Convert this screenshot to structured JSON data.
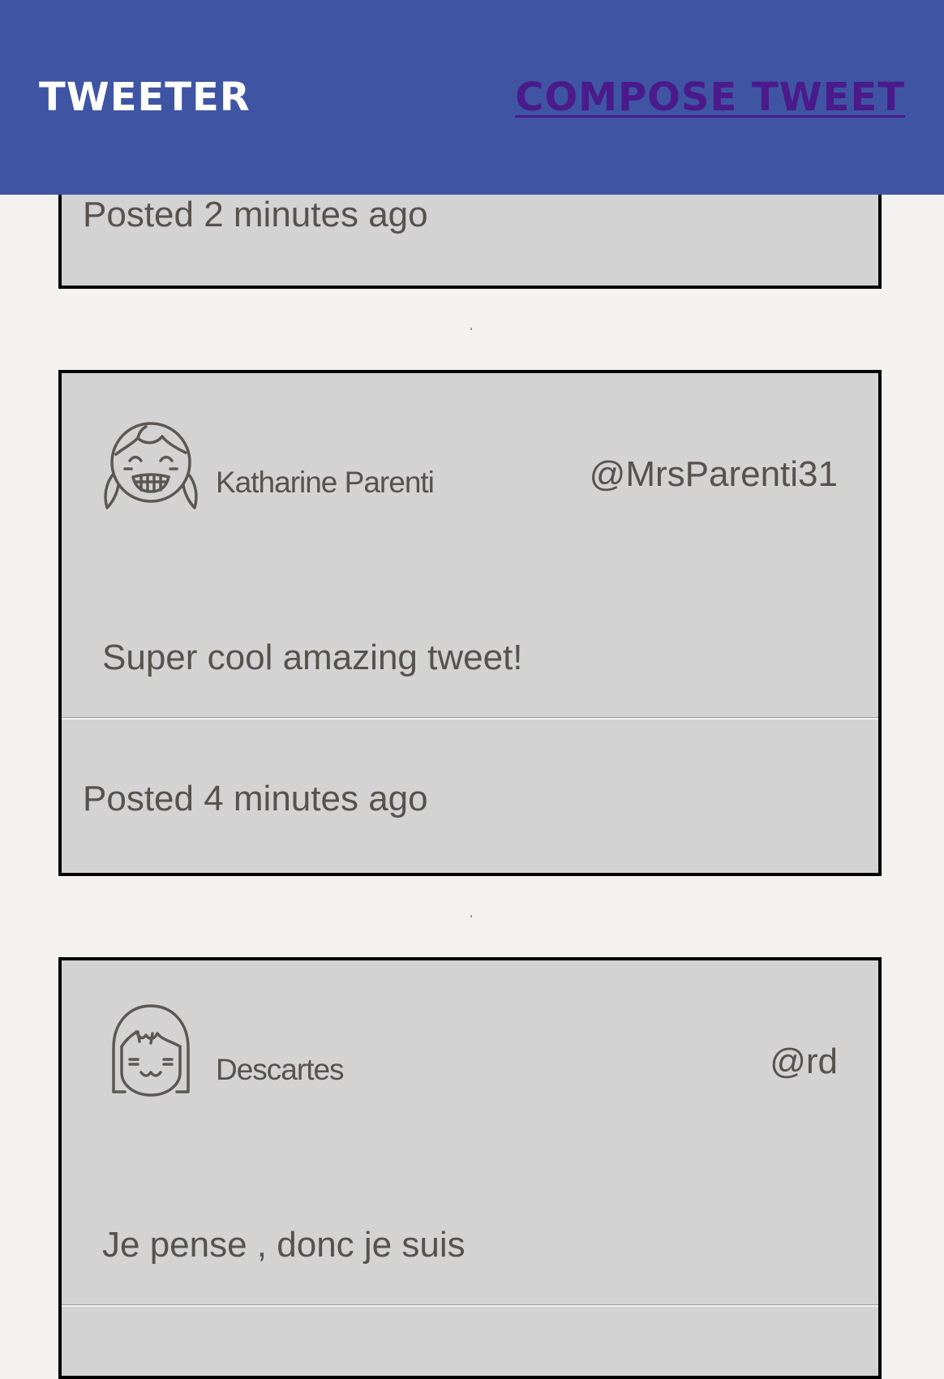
{
  "navbar": {
    "brand": "TWEETER",
    "compose_label": "COMPOSE TWEET"
  },
  "tweets": [
    {
      "footer": "Posted 2 minutes ago"
    },
    {
      "author": "Katharine Parenti",
      "handle": "@MrsParenti31",
      "text": "Super cool amazing tweet!",
      "footer": "Posted 4 minutes ago",
      "avatar_icon": "girl-grinning-avatar-icon"
    },
    {
      "author": "Descartes",
      "handle": "@rd",
      "text": "Je pense , donc je suis",
      "avatar_icon": "girl-smiling-avatar-icon"
    }
  ],
  "colors": {
    "navbar_bg": "#3f55a3",
    "brand_text": "#ffffff",
    "compose_link": "#4b1a8c",
    "page_bg": "#f4f2ee",
    "card_bg": "#d3d3d3",
    "text": "#56524d"
  }
}
